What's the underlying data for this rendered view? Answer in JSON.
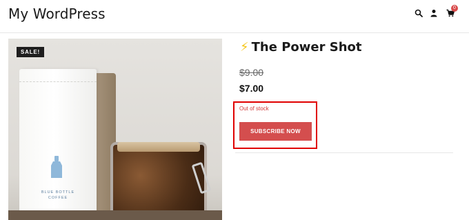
{
  "header": {
    "site_title": "My WordPress",
    "icons": [
      "search-icon",
      "user-icon",
      "cart-icon"
    ],
    "cart_count": "0"
  },
  "product": {
    "sale_badge": "SALE!",
    "title_icon": "⚡",
    "title": "The Power Shot",
    "old_price": "$9.00",
    "new_price": "$7.00",
    "stock_status": "Out of stock",
    "subscribe_label": "SUBSCRIBE NOW",
    "image": {
      "bag_line1": "BLUE BOTTLE",
      "bag_line2": "COFFEE"
    }
  },
  "colors": {
    "accent": "#d44e4e",
    "highlight": "#e00000",
    "badge": "#d94b4b"
  }
}
